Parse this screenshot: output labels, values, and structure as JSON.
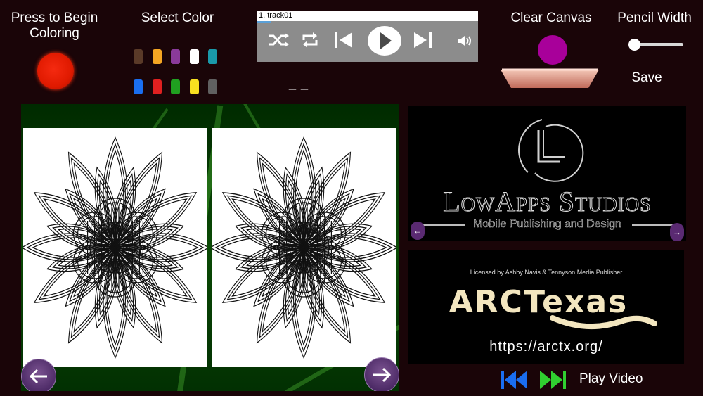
{
  "begin": {
    "label": "Press to Begin Coloring",
    "button_color": "#e01a00"
  },
  "palette": {
    "label": "Select Color",
    "colors": [
      "#5a3a28",
      "#f5a623",
      "#8a3a9a",
      "#ffffff",
      "#1a9aaa",
      "#1a6ef0",
      "#e02020",
      "#20a020",
      "#f8e020",
      "#606060"
    ],
    "selected_color": "#a8009a"
  },
  "player": {
    "track": "1.  track01",
    "status": "_ _"
  },
  "clear": {
    "label": "Clear Canvas"
  },
  "pencil": {
    "label": "Pencil Width",
    "value_fraction": 0.05
  },
  "save": {
    "label": "Save"
  },
  "lowapps": {
    "name": "LowApps Studios",
    "tagline": "Mobile Publishing and Design"
  },
  "arctx": {
    "credit": "Licensed by Ashby Navis & Tennyson Media Publisher",
    "name": "ARCTexas",
    "url": "https://arctx.org/"
  },
  "video": {
    "label": "Play Video"
  }
}
